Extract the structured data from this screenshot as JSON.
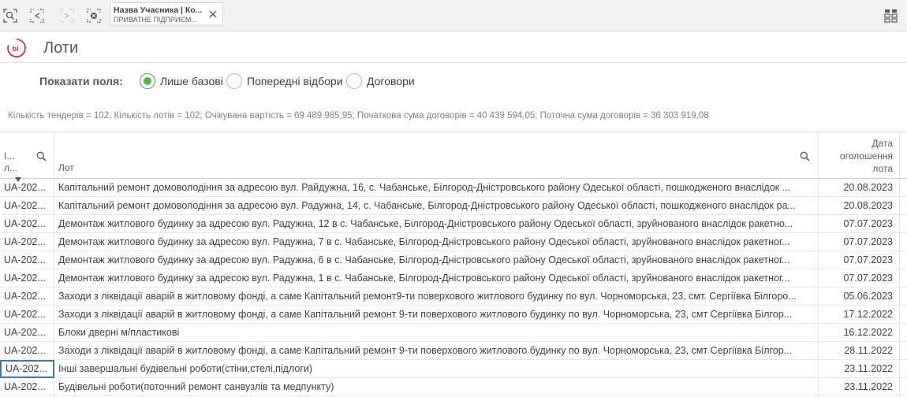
{
  "toolbar": {
    "icons": [
      "smart-search-icon",
      "selections-tool-icon",
      "step-forward-icon",
      "clear-selections-icon"
    ],
    "selection": {
      "title": "Назва Учасника | Ко...",
      "value": "ПРИВАТНЕ ПІДПРИЄМ..."
    },
    "sheet_grid_icon": "sheets-grid-icon"
  },
  "header": {
    "logo": "bi",
    "title": "Лоти"
  },
  "show_fields": {
    "label": "Показати поля:",
    "options": [
      {
        "label": "Лише базові",
        "checked": true
      },
      {
        "label": "Попередні відбори",
        "checked": false
      },
      {
        "label": "Договори",
        "checked": false
      }
    ]
  },
  "kpi_text": "Кількість тендерів = 102; Кількість лотів = 102; Очікувана вартість = 69 489 985,95; Початкова сума договорів = 40 439 594,05; Поточна сума договорів = 36 303 919,08",
  "table": {
    "columns": [
      {
        "line1": "І...",
        "line2": "л..."
      },
      {
        "label": "Лот"
      },
      {
        "label": "Дата оголошення лота"
      }
    ],
    "rows": [
      {
        "id": "UA-202...",
        "lot": "Капітальний ремонт домоволодіння за адресою вул. Райдужна, 16, с. Чабанське, Білгород-Дністровського району Одеської області, пошкодженого внаслідок ...",
        "date": "20.08.2023"
      },
      {
        "id": "UA-202...",
        "lot": "Капітальний ремонт домоволодіння за адресою вул. Радужна, 14, с. Чабанське, Білгород-Дністровського району Одеської області, пошкодженого внаслідок ра...",
        "date": "20.08.2023"
      },
      {
        "id": "UA-202...",
        "lot": "Демонтаж житлового будинку за адресою вул. Радужна, 12 в с. Чабанське, Білгород-Дністровського району Одеської області, зруйнованого внаслідок ракетно...",
        "date": "07.07.2023"
      },
      {
        "id": "UA-202...",
        "lot": "Демонтаж житлового будинку за адресою вул. Радужна, 7 в с. Чабанське, Білгород-Дністровського району Одеської області, зруйнованого внаслідок ракетног...",
        "date": "07.07.2023"
      },
      {
        "id": "UA-202...",
        "lot": "Демонтаж житлового будинку за адресою вул. Радужна, 6 в с. Чабанське, Білгород-Дністровського району Одеської області, зруйнованого внаслідок ракетног...",
        "date": "07.07.2023"
      },
      {
        "id": "UA-202...",
        "lot": "Демонтаж житлового будинку за адресою вул. Радужна, 1 в с. Чабанське, Білгород-Дністровського району Одеської області, зруйнованого внаслідок ракетног...",
        "date": "07.07.2023"
      },
      {
        "id": "UA-202...",
        "lot": "Заходи з ліквідації аварій в житловому фонді, а саме Капітальний ремонт9-ти поверхового житлового будинку по вул. Чорноморська, 23, смт. Сергіївка Білгоро...",
        "date": "05.06.2023"
      },
      {
        "id": "UA-202...",
        "lot": "Заходи з ліквідації аварій в житловому фонді, а саме Капітальний ремонт 9-ти поверхового житлового будинку по вул. Чорноморська, 23, смт Сергіївка Білгор...",
        "date": "17.12.2022"
      },
      {
        "id": "UA-202...",
        "lot": "Блоки дверні м/пластикові",
        "date": "16.12.2022"
      },
      {
        "id": "UA-202...",
        "lot": "Заходи з ліквідації аварій в житловому фонді, а саме Капітальний ремонт 9-ти поверхового житлового будинку по вул. Чорноморська, 23, смт Сергіївка Білгор...",
        "date": "28.11.2022"
      },
      {
        "id": "UA-202...",
        "lot": "Інші завершальні будівельні роботи(стіни,стелі,підлоги)",
        "date": "23.11.2022",
        "selected": true
      },
      {
        "id": "UA-202...",
        "lot": "Будівельні роботи(поточний ремонт санвузлів та медпункту)",
        "date": "23.11.2022"
      }
    ]
  }
}
